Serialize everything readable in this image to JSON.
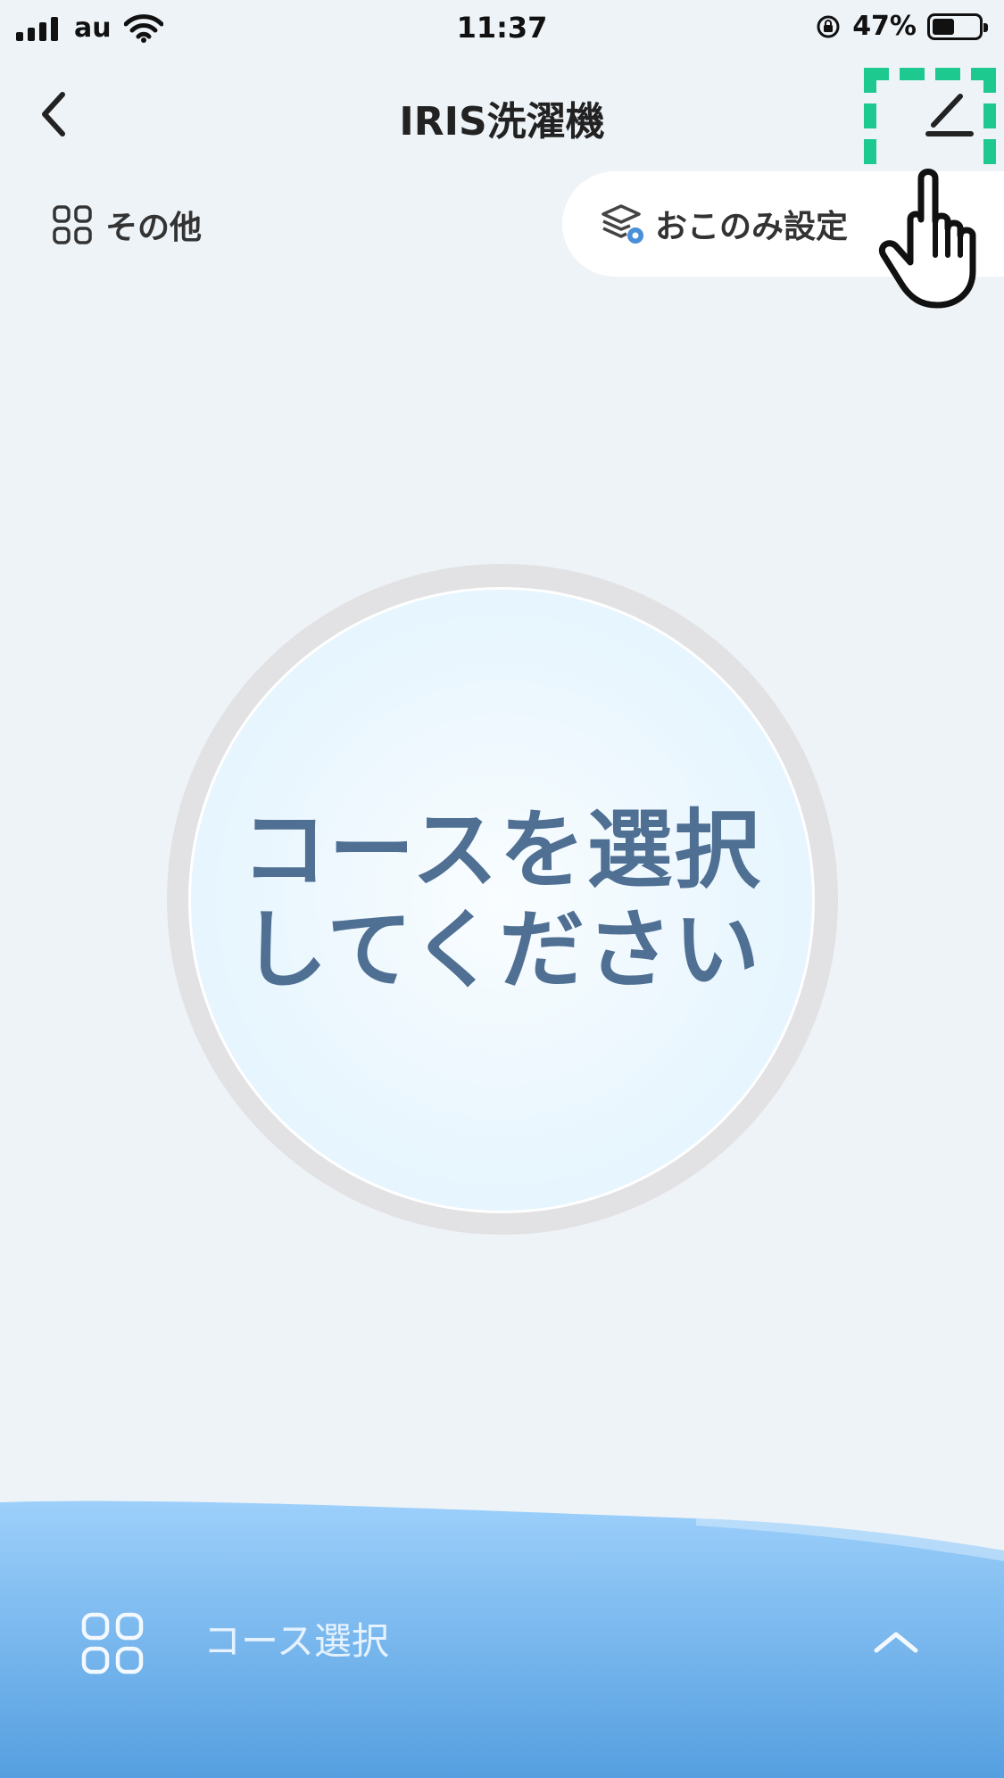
{
  "status_bar": {
    "carrier": "au",
    "time": "11:37",
    "battery_percent": "47%",
    "battery_level": 0.47
  },
  "nav": {
    "title": "IRIS洗濯機"
  },
  "toolbar": {
    "other_label": "その他",
    "preference_label": "おこのみ設定"
  },
  "dial": {
    "line1": "コースを選択",
    "line2": "してください"
  },
  "bottom": {
    "course_select_label": "コース選択"
  },
  "colors": {
    "background": "#eef3f7",
    "highlight": "#1ec98f",
    "dial_text": "#4f6f93",
    "wave_top": "#9dd0fb",
    "wave_bottom": "#559fe0"
  }
}
